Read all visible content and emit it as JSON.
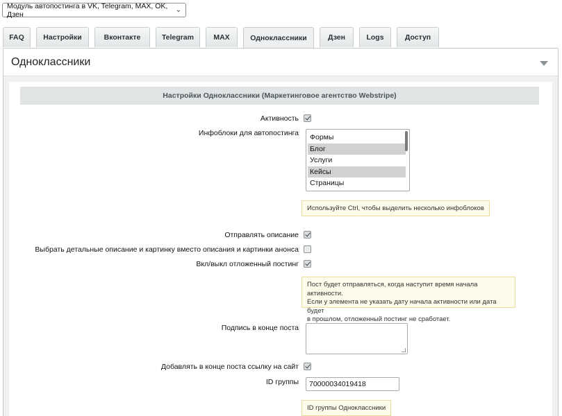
{
  "module_select": {
    "value": "Модуль автопостинга в VK, Telegram, MAX, OK, Дзен"
  },
  "tabs": [
    {
      "label": "FAQ"
    },
    {
      "label": "Настройки"
    },
    {
      "label": "Вконтакте"
    },
    {
      "label": "Telegram"
    },
    {
      "label": "MAX"
    },
    {
      "label": "Одноклассники",
      "active": true
    },
    {
      "label": "Дзен"
    },
    {
      "label": "Logs"
    },
    {
      "label": "Доступ"
    }
  ],
  "panel": {
    "title": "Одноклассники"
  },
  "section": {
    "title": "Настройки Одноклассники (Маркетинговое агентство Webstripe)"
  },
  "fields": {
    "activity": {
      "label": "Активность",
      "checked": true
    },
    "iblocks": {
      "label": "Инфоблоки для автопостинга",
      "options": [
        {
          "label": "Формы",
          "selected": false
        },
        {
          "label": "Блог",
          "selected": true
        },
        {
          "label": "Услуги",
          "selected": false
        },
        {
          "label": "Кейсы",
          "selected": true
        },
        {
          "label": "Страницы",
          "selected": false
        }
      ],
      "hint": "Используйте Ctrl, чтобы выделить несколько инфоблоков"
    },
    "send_description": {
      "label": "Отправлять описание",
      "checked": true
    },
    "detail_instead": {
      "label": "Выбрать детальные описание и картинку вместо описания и картинки анонса",
      "checked": false
    },
    "delayed_posting": {
      "label": "Вкл/выкл отложенный постинг",
      "checked": true,
      "hint_lines": [
        "Пост будет отправляться, когда наступит время начала активности.",
        "Если у элемента не указать дату начала активности или дата будет",
        "в прошлом, отложенный постинг не сработает."
      ]
    },
    "signature": {
      "label": "Подпись в конце поста",
      "value": ""
    },
    "add_link": {
      "label": "Добавлять в конце поста ссылку на сайт",
      "checked": true
    },
    "group_id": {
      "label": "ID группы",
      "value": "70000034019418",
      "hint": "ID группы Одноклассники"
    }
  }
}
